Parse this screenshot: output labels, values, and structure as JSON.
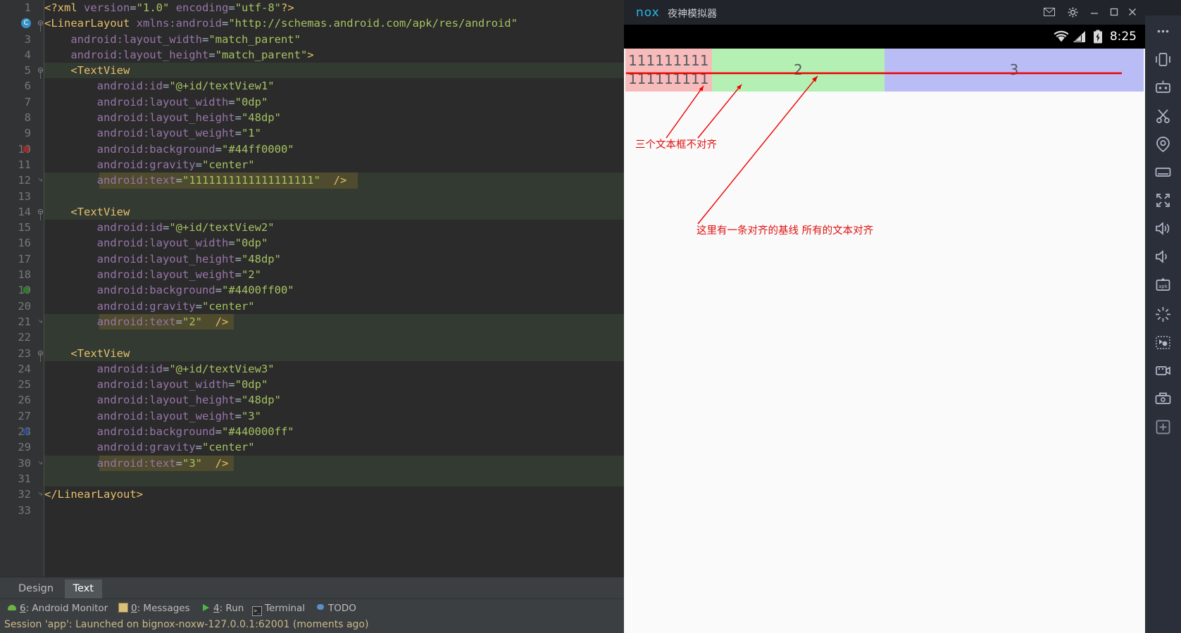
{
  "ide": {
    "code_lines": [
      {
        "n": 1,
        "mark": "",
        "fold": "",
        "hl": "",
        "tokens": [
          {
            "c": "t-tag",
            "s": "<?xml "
          },
          {
            "c": "t-attr",
            "s": "version"
          },
          {
            "c": "t-punct",
            "s": "="
          },
          {
            "c": "t-val",
            "s": "\"1.0\""
          },
          {
            "c": "t-plain",
            "s": " "
          },
          {
            "c": "t-attr",
            "s": "encoding"
          },
          {
            "c": "t-punct",
            "s": "="
          },
          {
            "c": "t-val",
            "s": "\"utf-8\""
          },
          {
            "c": "t-tag",
            "s": "?>"
          }
        ]
      },
      {
        "n": 2,
        "mark": "class",
        "fold": "minus",
        "hl": "",
        "tokens": [
          {
            "c": "t-tag",
            "s": "<LinearLayout "
          },
          {
            "c": "t-attr",
            "s": "xmlns:android"
          },
          {
            "c": "t-punct",
            "s": "="
          },
          {
            "c": "t-val",
            "s": "\"http://schemas.android.com/apk/res/android\""
          }
        ]
      },
      {
        "n": 3,
        "mark": "",
        "fold": "",
        "hl": "",
        "tokens": [
          {
            "c": "t-plain",
            "s": "    "
          },
          {
            "c": "t-attr",
            "s": "android:layout_width"
          },
          {
            "c": "t-punct",
            "s": "="
          },
          {
            "c": "t-val",
            "s": "\"match_parent\""
          }
        ]
      },
      {
        "n": 4,
        "mark": "",
        "fold": "",
        "hl": "",
        "tokens": [
          {
            "c": "t-plain",
            "s": "    "
          },
          {
            "c": "t-attr",
            "s": "android:layout_height"
          },
          {
            "c": "t-punct",
            "s": "="
          },
          {
            "c": "t-val",
            "s": "\"match_parent\""
          },
          {
            "c": "t-tag",
            "s": ">"
          }
        ]
      },
      {
        "n": 5,
        "mark": "",
        "fold": "minus",
        "hl": "green5",
        "tokens": [
          {
            "c": "t-plain",
            "s": "    "
          },
          {
            "c": "t-tag",
            "s": "<TextView"
          }
        ]
      },
      {
        "n": 6,
        "mark": "",
        "fold": "",
        "hl": "",
        "tokens": [
          {
            "c": "t-plain",
            "s": "        "
          },
          {
            "c": "t-attr",
            "s": "android:id"
          },
          {
            "c": "t-punct",
            "s": "="
          },
          {
            "c": "t-val",
            "s": "\"@+id/textView1\""
          }
        ]
      },
      {
        "n": 7,
        "mark": "",
        "fold": "",
        "hl": "",
        "tokens": [
          {
            "c": "t-plain",
            "s": "        "
          },
          {
            "c": "t-attr",
            "s": "android:layout_width"
          },
          {
            "c": "t-punct",
            "s": "="
          },
          {
            "c": "t-val",
            "s": "\"0dp\""
          }
        ]
      },
      {
        "n": 8,
        "mark": "",
        "fold": "",
        "hl": "",
        "tokens": [
          {
            "c": "t-plain",
            "s": "        "
          },
          {
            "c": "t-attr",
            "s": "android:layout_height"
          },
          {
            "c": "t-punct",
            "s": "="
          },
          {
            "c": "t-val",
            "s": "\"48dp\""
          }
        ]
      },
      {
        "n": 9,
        "mark": "",
        "fold": "",
        "hl": "",
        "tokens": [
          {
            "c": "t-plain",
            "s": "        "
          },
          {
            "c": "t-attr",
            "s": "android:layout_weight"
          },
          {
            "c": "t-punct",
            "s": "="
          },
          {
            "c": "t-val",
            "s": "\"1\""
          }
        ]
      },
      {
        "n": 10,
        "mark": "red",
        "fold": "",
        "hl": "",
        "tokens": [
          {
            "c": "t-plain",
            "s": "        "
          },
          {
            "c": "t-attr",
            "s": "android:background"
          },
          {
            "c": "t-punct",
            "s": "="
          },
          {
            "c": "t-val",
            "s": "\"#44ff0000\""
          }
        ]
      },
      {
        "n": 11,
        "mark": "",
        "fold": "",
        "hl": "",
        "tokens": [
          {
            "c": "t-plain",
            "s": "        "
          },
          {
            "c": "t-attr",
            "s": "android:gravity"
          },
          {
            "c": "t-punct",
            "s": "="
          },
          {
            "c": "t-val",
            "s": "\"center\""
          }
        ]
      },
      {
        "n": 12,
        "mark": "",
        "fold": "minus-end",
        "hl": "olive12",
        "tokens": [
          {
            "c": "t-plain",
            "s": "        "
          },
          {
            "c": "t-attr",
            "s": "android:text"
          },
          {
            "c": "t-punct",
            "s": "="
          },
          {
            "c": "t-val",
            "s": "\"1111111111111111111\""
          },
          {
            "c": "t-plain",
            "s": "  "
          },
          {
            "c": "t-tag",
            "s": "/>"
          }
        ]
      },
      {
        "n": 13,
        "mark": "",
        "fold": "",
        "hl": "green-full",
        "tokens": [
          {
            "c": "t-plain",
            "s": ""
          }
        ]
      },
      {
        "n": 14,
        "mark": "",
        "fold": "minus",
        "hl": "green5",
        "tokens": [
          {
            "c": "t-plain",
            "s": "    "
          },
          {
            "c": "t-tag",
            "s": "<TextView"
          }
        ]
      },
      {
        "n": 15,
        "mark": "",
        "fold": "",
        "hl": "",
        "tokens": [
          {
            "c": "t-plain",
            "s": "        "
          },
          {
            "c": "t-attr",
            "s": "android:id"
          },
          {
            "c": "t-punct",
            "s": "="
          },
          {
            "c": "t-val",
            "s": "\"@+id/textView2\""
          }
        ]
      },
      {
        "n": 16,
        "mark": "",
        "fold": "",
        "hl": "",
        "tokens": [
          {
            "c": "t-plain",
            "s": "        "
          },
          {
            "c": "t-attr",
            "s": "android:layout_width"
          },
          {
            "c": "t-punct",
            "s": "="
          },
          {
            "c": "t-val",
            "s": "\"0dp\""
          }
        ]
      },
      {
        "n": 17,
        "mark": "",
        "fold": "",
        "hl": "",
        "tokens": [
          {
            "c": "t-plain",
            "s": "        "
          },
          {
            "c": "t-attr",
            "s": "android:layout_height"
          },
          {
            "c": "t-punct",
            "s": "="
          },
          {
            "c": "t-val",
            "s": "\"48dp\""
          }
        ]
      },
      {
        "n": 18,
        "mark": "",
        "fold": "",
        "hl": "",
        "tokens": [
          {
            "c": "t-plain",
            "s": "        "
          },
          {
            "c": "t-attr",
            "s": "android:layout_weight"
          },
          {
            "c": "t-punct",
            "s": "="
          },
          {
            "c": "t-val",
            "s": "\"2\""
          }
        ]
      },
      {
        "n": 19,
        "mark": "green",
        "fold": "",
        "hl": "",
        "tokens": [
          {
            "c": "t-plain",
            "s": "        "
          },
          {
            "c": "t-attr",
            "s": "android:background"
          },
          {
            "c": "t-punct",
            "s": "="
          },
          {
            "c": "t-val",
            "s": "\"#4400ff00\""
          }
        ]
      },
      {
        "n": 20,
        "mark": "",
        "fold": "",
        "hl": "",
        "tokens": [
          {
            "c": "t-plain",
            "s": "        "
          },
          {
            "c": "t-attr",
            "s": "android:gravity"
          },
          {
            "c": "t-punct",
            "s": "="
          },
          {
            "c": "t-val",
            "s": "\"center\""
          }
        ]
      },
      {
        "n": 21,
        "mark": "",
        "fold": "minus-end",
        "hl": "olive21",
        "tokens": [
          {
            "c": "t-plain",
            "s": "        "
          },
          {
            "c": "t-attr",
            "s": "android:text"
          },
          {
            "c": "t-punct",
            "s": "="
          },
          {
            "c": "t-val",
            "s": "\"2\""
          },
          {
            "c": "t-plain",
            "s": "  "
          },
          {
            "c": "t-tag",
            "s": "/>"
          }
        ]
      },
      {
        "n": 22,
        "mark": "",
        "fold": "",
        "hl": "green-full",
        "tokens": [
          {
            "c": "t-plain",
            "s": ""
          }
        ]
      },
      {
        "n": 23,
        "mark": "",
        "fold": "minus",
        "hl": "green5",
        "tokens": [
          {
            "c": "t-plain",
            "s": "    "
          },
          {
            "c": "t-tag",
            "s": "<TextView"
          }
        ]
      },
      {
        "n": 24,
        "mark": "",
        "fold": "",
        "hl": "",
        "tokens": [
          {
            "c": "t-plain",
            "s": "        "
          },
          {
            "c": "t-attr",
            "s": "android:id"
          },
          {
            "c": "t-punct",
            "s": "="
          },
          {
            "c": "t-val",
            "s": "\"@+id/textView3\""
          }
        ]
      },
      {
        "n": 25,
        "mark": "",
        "fold": "",
        "hl": "",
        "tokens": [
          {
            "c": "t-plain",
            "s": "        "
          },
          {
            "c": "t-attr",
            "s": "android:layout_width"
          },
          {
            "c": "t-punct",
            "s": "="
          },
          {
            "c": "t-val",
            "s": "\"0dp\""
          }
        ]
      },
      {
        "n": 26,
        "mark": "",
        "fold": "",
        "hl": "",
        "tokens": [
          {
            "c": "t-plain",
            "s": "        "
          },
          {
            "c": "t-attr",
            "s": "android:layout_height"
          },
          {
            "c": "t-punct",
            "s": "="
          },
          {
            "c": "t-val",
            "s": "\"48dp\""
          }
        ]
      },
      {
        "n": 27,
        "mark": "",
        "fold": "",
        "hl": "",
        "tokens": [
          {
            "c": "t-plain",
            "s": "        "
          },
          {
            "c": "t-attr",
            "s": "android:layout_weight"
          },
          {
            "c": "t-punct",
            "s": "="
          },
          {
            "c": "t-val",
            "s": "\"3\""
          }
        ]
      },
      {
        "n": 28,
        "mark": "blue",
        "fold": "",
        "hl": "",
        "tokens": [
          {
            "c": "t-plain",
            "s": "        "
          },
          {
            "c": "t-attr",
            "s": "android:background"
          },
          {
            "c": "t-punct",
            "s": "="
          },
          {
            "c": "t-val",
            "s": "\"#440000ff\""
          }
        ]
      },
      {
        "n": 29,
        "mark": "",
        "fold": "",
        "hl": "",
        "tokens": [
          {
            "c": "t-plain",
            "s": "        "
          },
          {
            "c": "t-attr",
            "s": "android:gravity"
          },
          {
            "c": "t-punct",
            "s": "="
          },
          {
            "c": "t-val",
            "s": "\"center\""
          }
        ]
      },
      {
        "n": 30,
        "mark": "",
        "fold": "minus-end",
        "hl": "olive21",
        "tokens": [
          {
            "c": "t-plain",
            "s": "        "
          },
          {
            "c": "t-attr",
            "s": "android:text"
          },
          {
            "c": "t-punct",
            "s": "="
          },
          {
            "c": "t-val",
            "s": "\"3\""
          },
          {
            "c": "t-plain",
            "s": "  "
          },
          {
            "c": "t-tag",
            "s": "/>"
          }
        ]
      },
      {
        "n": 31,
        "mark": "",
        "fold": "",
        "hl": "green-full",
        "tokens": [
          {
            "c": "t-plain",
            "s": ""
          }
        ]
      },
      {
        "n": 32,
        "mark": "",
        "fold": "minus-end",
        "hl": "",
        "tokens": [
          {
            "c": "t-tag",
            "s": "</LinearLayout>"
          }
        ]
      },
      {
        "n": 33,
        "mark": "",
        "fold": "",
        "hl": "",
        "tokens": [
          {
            "c": "t-plain",
            "s": ""
          }
        ]
      }
    ],
    "editor_tabs": [
      {
        "label": "Design",
        "selected": false
      },
      {
        "label": "Text",
        "selected": true
      }
    ],
    "tool_window_buttons": [
      {
        "num": "6",
        "label": ": Android Monitor",
        "icon": "android-icon"
      },
      {
        "num": "0",
        "label": ": Messages",
        "icon": "messages-icon"
      },
      {
        "num": "4",
        "label": ": Run",
        "icon": "run-icon"
      },
      {
        "num": "",
        "label": "Terminal",
        "icon": "terminal-icon"
      },
      {
        "num": "",
        "label": "TODO",
        "icon": "todo-icon"
      }
    ],
    "status_text": "Session 'app': Launched on bignox-noxw-127.0.0.1:62001 (moments ago)"
  },
  "nox": {
    "logo": "nox",
    "title": "夜神模拟器",
    "window_buttons": [
      {
        "name": "mail-icon",
        "glyph": "✉"
      },
      {
        "name": "gear-icon",
        "glyph": "⚙"
      },
      {
        "name": "minimize-icon",
        "glyph": "–"
      },
      {
        "name": "maximize-icon",
        "glyph": "☐"
      },
      {
        "name": "close-icon",
        "glyph": "✕"
      }
    ],
    "statusbar": {
      "clock": "8:25",
      "icons": [
        "wifi-icon",
        "signal-icon",
        "battery-charging-icon"
      ]
    },
    "app": {
      "textviews": [
        {
          "id": "textView1",
          "text": "1111111111111111111",
          "bg": "#f8bbbb",
          "weight": 1
        },
        {
          "id": "textView2",
          "text": "2",
          "bg": "#b4f0b4",
          "weight": 2
        },
        {
          "id": "textView3",
          "text": "3",
          "bg": "#b9bcf5",
          "weight": 3
        }
      ]
    },
    "annotations": [
      {
        "text": "三个文本框不对齐"
      },
      {
        "text": "这里有一条对齐的基线  所有的文本对齐"
      }
    ],
    "sidebar_icons": [
      "more-icon",
      "shake-phone-icon",
      "gamepad-keymap-icon",
      "scissors-icon",
      "location-icon",
      "display-icon",
      "fullscreen-icon",
      "volume-up-icon",
      "volume-down-icon",
      "apk-install-icon",
      "clean-icon",
      "macro-script-icon",
      "video-record-icon",
      "screenshot-icon",
      "add-instance-icon"
    ]
  },
  "colors": {
    "editor_bg": "#2b2b2b",
    "gutter_bg": "#313335",
    "annotation_red": "#e01010",
    "tv1_bg": "#f8bbbb",
    "tv2_bg": "#b4f0b4",
    "tv3_bg": "#b9bcf5",
    "nox_accent": "#27b6e8"
  }
}
